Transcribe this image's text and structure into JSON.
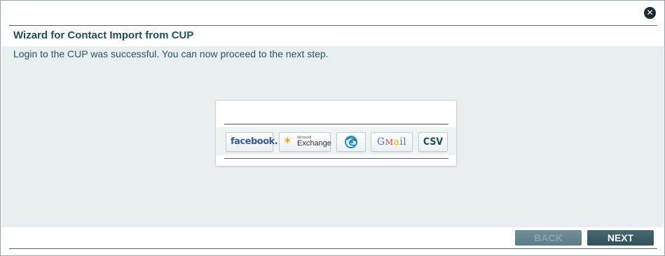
{
  "dialog": {
    "title": "Wizard for Contact Import from CUP",
    "message": "Login to the CUP was successful. You can now proceed to the next step.",
    "close_icon": "close-icon"
  },
  "sources": [
    {
      "name": "facebook",
      "label": "facebook."
    },
    {
      "name": "exchange",
      "small_label": "Microsoft",
      "label": "Exchange"
    },
    {
      "name": "globe",
      "icon": "globe-icon"
    },
    {
      "name": "gmail",
      "label_g": "G",
      "label_m": "M",
      "label_a": "a",
      "label_i": "i",
      "label_l": "l"
    },
    {
      "name": "csv",
      "label": "CSV"
    }
  ],
  "buttons": {
    "back": "BACK",
    "next": "NEXT"
  },
  "colors": {
    "title": "#1f4d5c",
    "content_bg": "#e9eff1",
    "button": "#3b5f6a",
    "facebook": "#3b5998",
    "gmail_g": "#4a78d0",
    "gmail_m": "#d6422a",
    "gmail_a": "#f2b100",
    "gmail_i": "#3aa04a",
    "gmail_l": "#4a78d0"
  }
}
